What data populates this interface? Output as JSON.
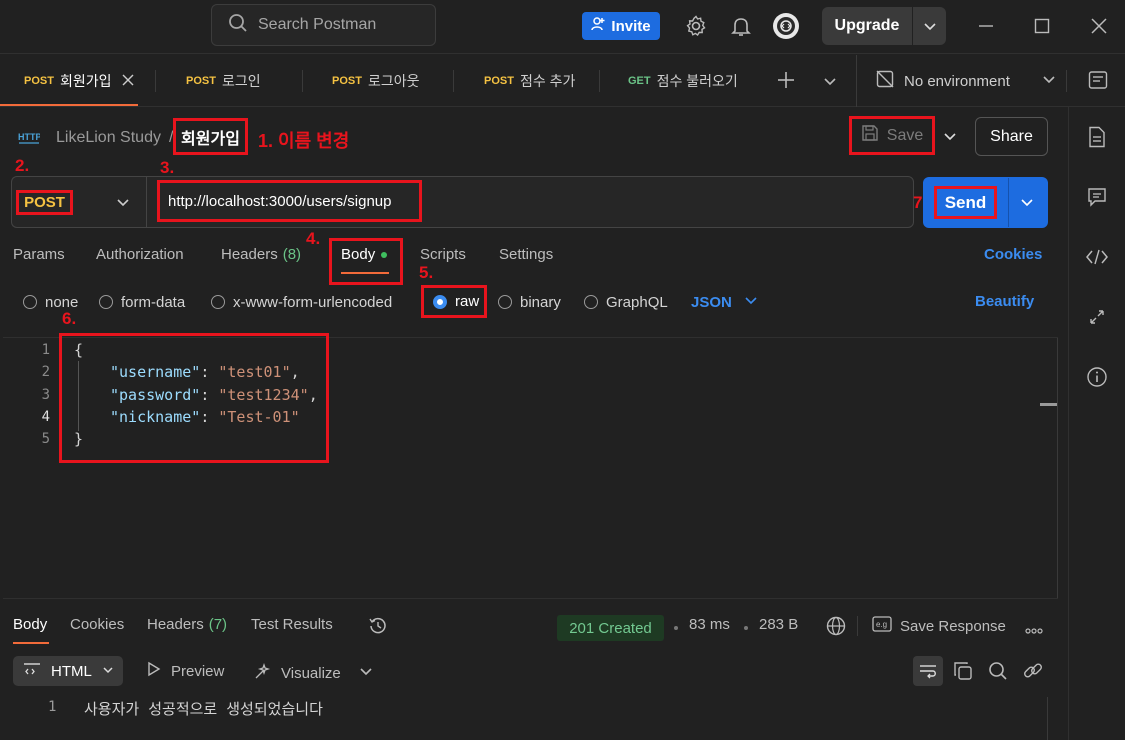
{
  "titlebar": {
    "search_placeholder": "Search Postman",
    "invite_label": "Invite",
    "upgrade_label": "Upgrade"
  },
  "tabs": [
    {
      "method": "POST",
      "label": "회원가입",
      "active": true
    },
    {
      "method": "POST",
      "label": "로그인"
    },
    {
      "method": "POST",
      "label": "로그아웃"
    },
    {
      "method": "POST",
      "label": "점수 추가"
    },
    {
      "method": "GET",
      "label": "점수 불러오기"
    }
  ],
  "environment": {
    "label": "No environment"
  },
  "breadcrumb": {
    "collection": "LikeLion Study",
    "separator": "/",
    "request_name": "회원가입"
  },
  "actions": {
    "save_label": "Save",
    "share_label": "Share",
    "send_label": "Send"
  },
  "request": {
    "method": "POST",
    "url": "http://localhost:3000/users/signup"
  },
  "request_tabs": {
    "params": "Params",
    "authorization": "Authorization",
    "headers": "Headers",
    "headers_count": "(8)",
    "body": "Body",
    "scripts": "Scripts",
    "settings": "Settings",
    "cookies": "Cookies"
  },
  "body_types": {
    "none": "none",
    "form_data": "form-data",
    "urlencoded": "x-www-form-urlencoded",
    "raw": "raw",
    "binary": "binary",
    "graphql": "GraphQL",
    "format": "JSON",
    "beautify": "Beautify",
    "selected": "raw"
  },
  "editor": {
    "line_numbers": [
      "1",
      "2",
      "3",
      "4",
      "5"
    ],
    "open_brace": "{",
    "close_brace": "}",
    "fields": [
      {
        "key": "\"username\"",
        "value": "\"test01\"",
        "comma": ","
      },
      {
        "key": "\"password\"",
        "value": "\"test1234\"",
        "comma": ","
      },
      {
        "key": "\"nickname\"",
        "value": "\"Test-01\"",
        "comma": ""
      }
    ]
  },
  "annotations": {
    "a1": "1. 이름 변경",
    "a2": "2.",
    "a3": "3.",
    "a4": "4.",
    "a5": "5.",
    "a6": "6.",
    "a7": "7."
  },
  "response": {
    "tabs": {
      "body": "Body",
      "cookies": "Cookies",
      "headers": "Headers",
      "headers_count": "(7)",
      "test_results": "Test Results"
    },
    "status": "201 Created",
    "time": "83 ms",
    "size": "283 B",
    "save_response": "Save Response",
    "view_format": "HTML",
    "preview": "Preview",
    "visualize": "Visualize",
    "line_number": "1",
    "body_text": "사용자가 성공적으로 생성되었습니다"
  },
  "colors": {
    "accent_blue": "#1d6ce0",
    "annotation_red": "#e8141d",
    "post_yellow": "#f5c242",
    "get_green": "#6bc387",
    "status_green": "#73c991"
  }
}
